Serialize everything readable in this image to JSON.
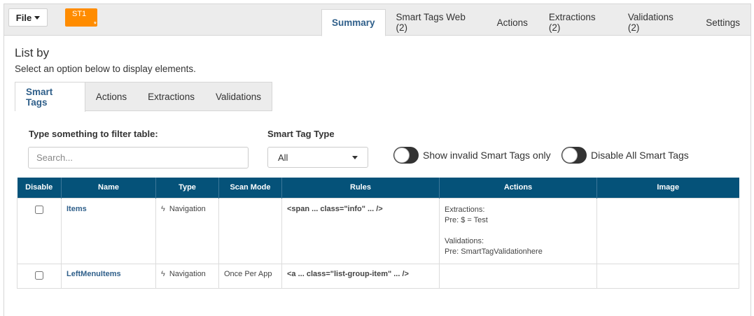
{
  "toolbar": {
    "file_label": "File",
    "badge_label": "ST1",
    "badge_star": "*"
  },
  "tabs": [
    "Summary",
    "Smart Tags Web (2)",
    "Actions",
    "Extractions (2)",
    "Validations (2)",
    "Settings"
  ],
  "list_by": {
    "title": "List by",
    "subtitle": "Select an option below to display elements."
  },
  "subtabs": [
    "Smart Tags",
    "Actions",
    "Extractions",
    "Validations"
  ],
  "filter": {
    "label": "Type something to filter table:",
    "placeholder": "Search..."
  },
  "smart_tag_type": {
    "label": "Smart Tag Type",
    "selected": "All"
  },
  "toggles": {
    "invalid_label": "Show invalid Smart Tags only",
    "disable_label": "Disable All Smart Tags"
  },
  "table": {
    "columns": [
      "Disable",
      "Name",
      "Type",
      "Scan Mode",
      "Rules",
      "Actions",
      "Image"
    ],
    "rows": [
      {
        "name": "Items",
        "type": "Navigation",
        "scan_mode": "",
        "rules": "<span ... class=\"info\" ... />",
        "actions": [
          "Extractions:",
          "Pre: $ = Test",
          "Validations:",
          "Pre: SmartTagValidationhere"
        ],
        "image": ""
      },
      {
        "name": "LeftMenuItems",
        "type": "Navigation",
        "scan_mode": "Once Per App",
        "rules": "<a ... class=\"list-group-item\" ... />",
        "actions": [],
        "image": ""
      }
    ]
  }
}
